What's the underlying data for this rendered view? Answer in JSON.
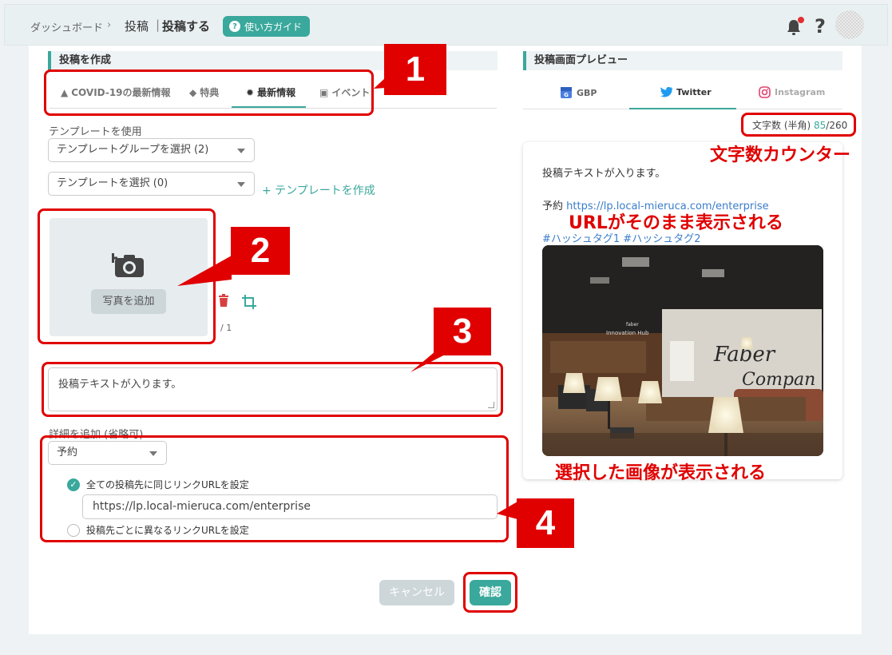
{
  "breadcrumb": {
    "home": "ダッシュボード",
    "separator": "›",
    "parent": "投稿",
    "divider": "|",
    "current": "投稿する"
  },
  "header": {
    "guide_button": "使い方ガイド",
    "help_icon": "?",
    "bell_icon": "bell-icon"
  },
  "left": {
    "section_title": "投稿を作成",
    "tabs": [
      {
        "label": "COVID-19の最新情報",
        "icon": "warning-icon"
      },
      {
        "label": "特典",
        "icon": "tag-icon"
      },
      {
        "label": "最新情報",
        "icon": "gear-icon"
      },
      {
        "label": "イベント",
        "icon": "calendar-icon"
      }
    ],
    "template_label": "テンプレートを使用",
    "template_group_select": "テンプレートグループを選択 (2)",
    "template_select": "テンプレートを選択 (0)",
    "create_template_link": "+ テンプレートを作成",
    "add_photo": "写真を追加",
    "photo_count": "/ 1",
    "post_text": "投稿テキストが入ります。",
    "details_label": "詳細を追加 (省略可)",
    "details_select": "予約",
    "radio_same_link": "全ての投稿先に同じリンクURLを設定",
    "link_url": "https://lp.local-mieruca.com/enterprise",
    "radio_diff_link": "投稿先ごとに異なるリンクURLを設定",
    "cancel": "キャンセル",
    "confirm": "確認"
  },
  "preview": {
    "section_title": "投稿画面プレビュー",
    "tabs": [
      {
        "label": "GBP",
        "icon": "gbp-icon"
      },
      {
        "label": "Twitter",
        "icon": "twitter-icon"
      },
      {
        "label": "Instagram",
        "icon": "instagram-icon"
      }
    ],
    "counter_label": "文字数 (半角)",
    "counter_current": "85",
    "counter_max": "/260",
    "text": "投稿テキストが入ります。",
    "link_prefix": "予約",
    "link": "https://lp.local-mieruca.com/enterprise",
    "hashtags": "#ハッシュタグ1 #ハッシュタグ2",
    "image_sign_small": "faber",
    "image_sign": "Innovation Hub",
    "image_wall_1": "Faber",
    "image_wall_2": "Compan"
  },
  "annotations": {
    "num1": "1",
    "num2": "2",
    "num3": "3",
    "num4": "4",
    "counter_note": "文字数カウンター",
    "url_note": "URLがそのまま表示される",
    "image_note": "選択した画像が表示される"
  },
  "colors": {
    "accent": "#3aa89c",
    "annotation": "#e00000",
    "link": "#3a7dc9"
  }
}
